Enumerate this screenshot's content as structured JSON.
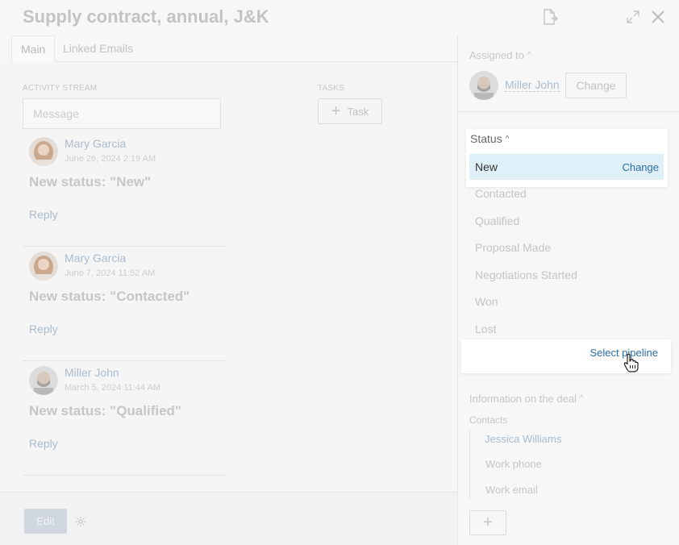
{
  "header": {
    "title": "Supply contract, annual, J&K",
    "icons": [
      "export-icon",
      "expand-icon",
      "close-icon"
    ]
  },
  "tabs": [
    {
      "label": "Main",
      "active": true
    },
    {
      "label": "Linked Emails",
      "active": false
    }
  ],
  "activity": {
    "caption": "ACTIVITY STREAM",
    "message_placeholder": "Message",
    "tasks_caption": "TASKS",
    "task_button": "Task",
    "entries": [
      {
        "author": "Mary Garcia",
        "date": "June 26, 2024 2:19 AM",
        "text": "New status: \"New\"",
        "reply": "Reply",
        "avatar": "woman"
      },
      {
        "author": "Mary Garcia",
        "date": "June 7, 2024 11:52 AM",
        "text": "New status: \"Contacted\"",
        "reply": "Reply",
        "avatar": "woman"
      },
      {
        "author": "Miller John",
        "date": "March 5, 2024 11:44 AM",
        "text": "New status: \"Qualified\"",
        "reply": "Reply",
        "avatar": "man"
      }
    ]
  },
  "footer": {
    "edit_label": "Edit"
  },
  "assigned": {
    "label": "Assigned to",
    "name": "Miller John",
    "change_label": "Change"
  },
  "status": {
    "label": "Status",
    "current": "New",
    "change_label": "Change",
    "options": [
      "Contacted",
      "Qualified",
      "Proposal Made",
      "Negotiations Started",
      "Won",
      "Lost"
    ],
    "select_pipeline": "Select pipeline"
  },
  "deal_info": {
    "label": "Information on the deal",
    "contacts_label": "Contacts",
    "contact_name": "Jessica Williams",
    "work_phone": "Work phone",
    "work_email": "Work email"
  },
  "colors": {
    "link": "#2e6da4",
    "selected_row": "#dff0f8",
    "edit_button": "#cfd6de"
  }
}
